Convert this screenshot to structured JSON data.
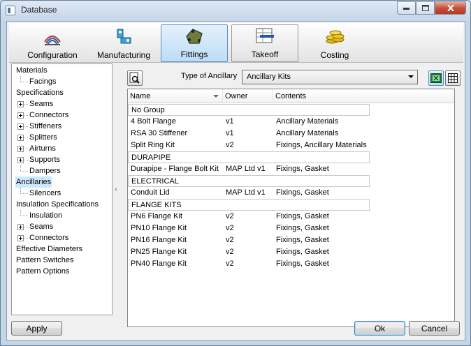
{
  "window": {
    "title": "Database"
  },
  "toolbar": {
    "items": [
      {
        "label": "Configuration",
        "icon": "configuration-icon"
      },
      {
        "label": "Manufacturing",
        "icon": "manufacturing-icon"
      },
      {
        "label": "Fittings",
        "icon": "fittings-icon",
        "active": true
      },
      {
        "label": "Takeoff",
        "icon": "takeoff-icon"
      },
      {
        "label": "Costing",
        "icon": "costing-icon"
      }
    ]
  },
  "tree": {
    "items": [
      {
        "label": "Materials",
        "level": 0
      },
      {
        "label": "Facings",
        "level": 1
      },
      {
        "label": "Specifications",
        "level": 0
      },
      {
        "label": "Seams",
        "level": 1,
        "expandable": true
      },
      {
        "label": "Connectors",
        "level": 1,
        "expandable": true
      },
      {
        "label": "Stiffeners",
        "level": 1,
        "expandable": true
      },
      {
        "label": "Splitters",
        "level": 1,
        "expandable": true
      },
      {
        "label": "Airturns",
        "level": 1,
        "expandable": true
      },
      {
        "label": "Supports",
        "level": 1,
        "expandable": true
      },
      {
        "label": "Dampers",
        "level": 1
      },
      {
        "label": "Ancillaries",
        "level": 0,
        "selected": true
      },
      {
        "label": "Silencers",
        "level": 1
      },
      {
        "label": "Insulation Specifications",
        "level": 0
      },
      {
        "label": "Insulation",
        "level": 1
      },
      {
        "label": "Seams",
        "level": 1,
        "expandable": true
      },
      {
        "label": "Connectors",
        "level": 1,
        "expandable": true
      },
      {
        "label": "Effective Diameters",
        "level": 0
      },
      {
        "label": "Pattern Switches",
        "level": 0
      },
      {
        "label": "Pattern Options",
        "level": 0
      }
    ]
  },
  "filter": {
    "label": "Type of Ancillary",
    "selected": "Ancillary Kits"
  },
  "list": {
    "columns": [
      "Name",
      "Owner",
      "Contents"
    ],
    "rows": [
      {
        "group": "No Group"
      },
      {
        "name": "4 Bolt Flange",
        "owner": "v1",
        "contents": "Ancillary Materials"
      },
      {
        "name": "RSA 30 Stiffener",
        "owner": "v1",
        "contents": "Ancillary Materials"
      },
      {
        "name": "Split Ring Kit",
        "owner": "v2",
        "contents": "Fixings, Ancillary Materials"
      },
      {
        "group": "DURAPIPE"
      },
      {
        "name": "Durapipe - Flange Bolt Kit",
        "owner": "MAP Ltd v1",
        "contents": "Fixings, Gasket"
      },
      {
        "group": "ELECTRICAL"
      },
      {
        "name": "Conduit Lid",
        "owner": "MAP Ltd v1",
        "contents": "Fixings, Gasket"
      },
      {
        "group": "FLANGE KITS"
      },
      {
        "name": "PN6 Flange Kit",
        "owner": "v2",
        "contents": "Fixings, Gasket"
      },
      {
        "name": "PN10 Flange Kit",
        "owner": "v2",
        "contents": "Fixings, Gasket"
      },
      {
        "name": "PN16 Flange Kit",
        "owner": "v2",
        "contents": "Fixings, Gasket"
      },
      {
        "name": "PN25 Flange Kit",
        "owner": "v2",
        "contents": "Fixings, Gasket"
      },
      {
        "name": "PN40 Flange Kit",
        "owner": "v2",
        "contents": "Fixings, Gasket"
      }
    ]
  },
  "buttons": {
    "apply": "Apply",
    "ok": "Ok",
    "cancel": "Cancel"
  },
  "colors": {
    "selection": "#cce8ff",
    "accent": "#5b8dc9",
    "close": "#c7503a"
  }
}
